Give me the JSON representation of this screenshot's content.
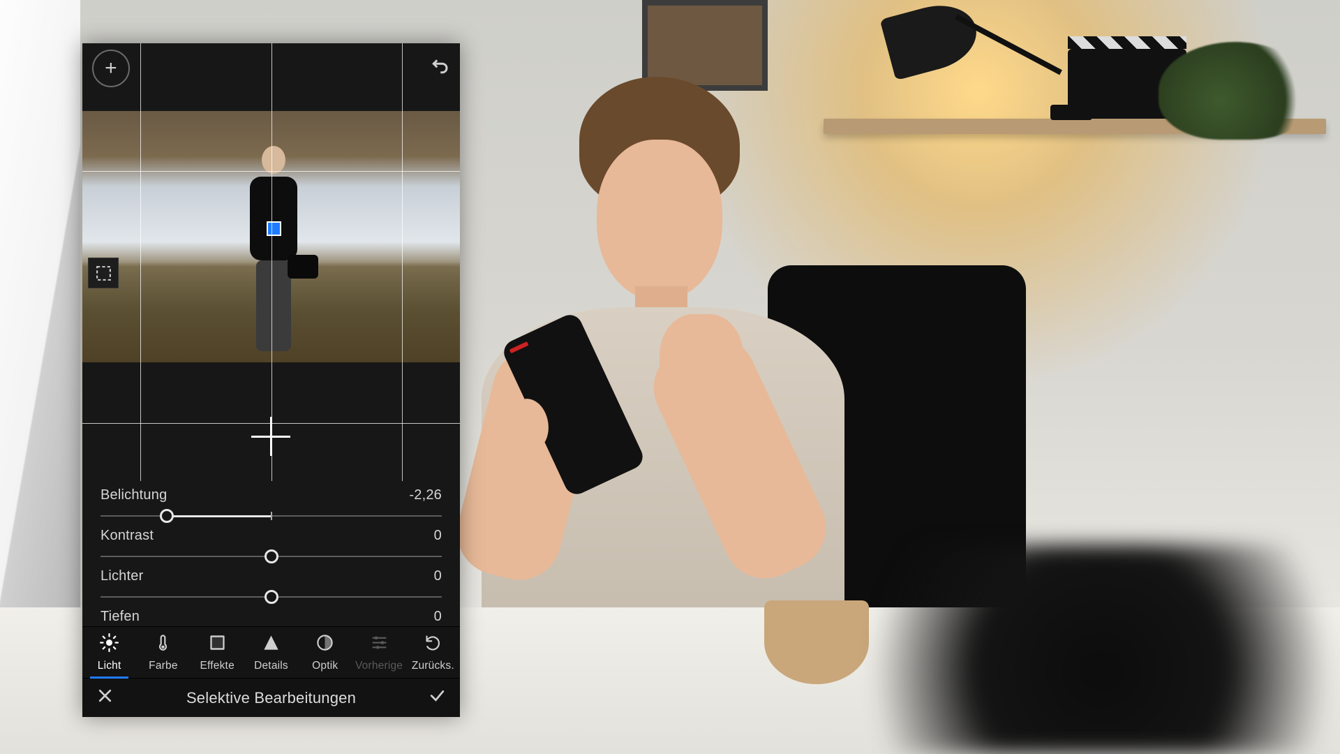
{
  "sliders": [
    {
      "label": "Belichtung",
      "value": "-2,26",
      "handle_pct": 19.5,
      "active_from_pct": 19.5,
      "active_to_pct": 50
    },
    {
      "label": "Kontrast",
      "value": "0",
      "handle_pct": 50
    },
    {
      "label": "Lichter",
      "value": "0",
      "handle_pct": 50
    },
    {
      "label": "Tiefen",
      "value": "0",
      "handle_pct": 50,
      "hide_track": true
    }
  ],
  "tools": [
    {
      "id": "licht",
      "label": "Licht",
      "icon": "sun",
      "state": "active"
    },
    {
      "id": "farbe",
      "label": "Farbe",
      "icon": "thermo",
      "state": ""
    },
    {
      "id": "effekte",
      "label": "Effekte",
      "icon": "square",
      "state": ""
    },
    {
      "id": "details",
      "label": "Details",
      "icon": "triangle",
      "state": ""
    },
    {
      "id": "optik",
      "label": "Optik",
      "icon": "lens",
      "state": ""
    },
    {
      "id": "vorherige",
      "label": "Vorherige",
      "icon": "sliders",
      "state": "disabled"
    },
    {
      "id": "zuruecks",
      "label": "Zurücks.",
      "icon": "reset",
      "state": ""
    }
  ],
  "confirm_title": "Selektive Bearbeitungen",
  "grid": {
    "v": [
      15.3,
      50.1,
      84.7
    ],
    "h": [
      20,
      85
    ]
  }
}
